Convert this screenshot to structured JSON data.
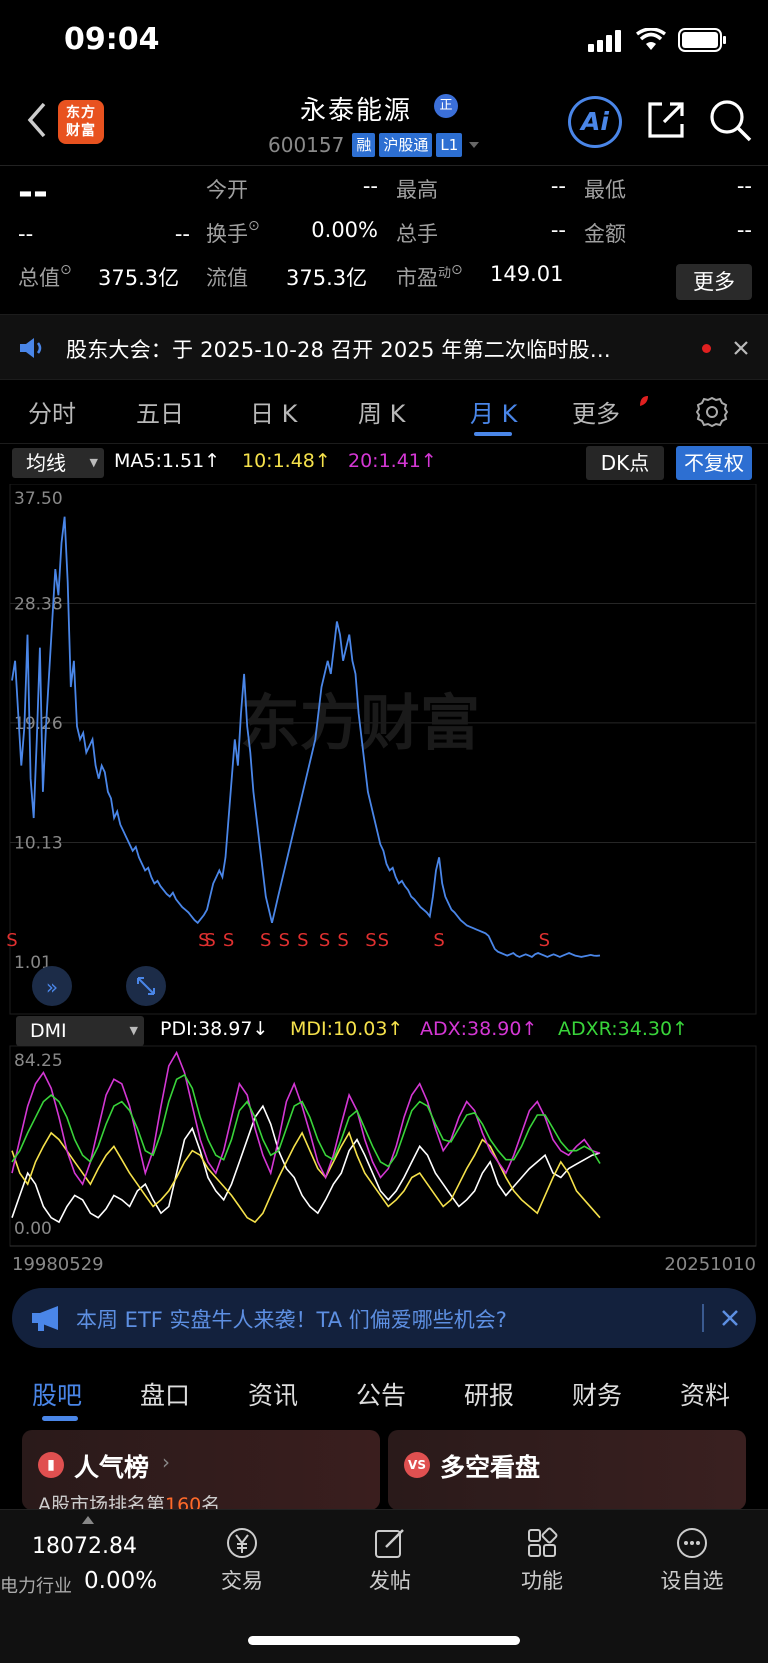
{
  "status_bar": {
    "time": "09:04"
  },
  "header": {
    "logo_text": "东方财富",
    "stock_name": "永泰能源",
    "badge": "正",
    "code": "600157",
    "tags": [
      "融",
      "沪股通",
      "L1"
    ],
    "ai_label": "Ai"
  },
  "quote": {
    "price": "--",
    "change": "--",
    "change_pct": "--",
    "open_label": "今开",
    "open": "--",
    "high_label": "最高",
    "high": "--",
    "low_label": "最低",
    "low": "--",
    "turnover_label": "换手",
    "turnover": "0.00%",
    "volume_label": "总手",
    "volume": "--",
    "amount_label": "金额",
    "amount": "--",
    "mktcap_label": "总值",
    "mktcap": "375.3亿",
    "float_label": "流值",
    "float": "375.3亿",
    "pe_label": "市盈",
    "pe_sup": "动",
    "pe": "149.01",
    "more": "更多"
  },
  "notice": {
    "text": "股东大会：于 2025-10-28 召开 2025 年第二次临时股…"
  },
  "period_tabs": [
    {
      "label": "分时"
    },
    {
      "label": "五日"
    },
    {
      "label": "日 K"
    },
    {
      "label": "周 K"
    },
    {
      "label": "月 K",
      "active": true
    },
    {
      "label": "更多"
    }
  ],
  "ma_bar": {
    "selector": "均线",
    "ma5": "MA5:1.51",
    "ma10": "10:1.48",
    "ma20": "20:1.41",
    "arrow": "↑",
    "dk": "DK点",
    "adjust": "不复权"
  },
  "colors": {
    "price_line": "#4a86e8",
    "ma10": "#f5e14b",
    "ma20": "#d437d4",
    "adxr": "#39d43a",
    "up": "#e03030",
    "accent": "#4a86e8"
  },
  "chart_data": [
    {
      "type": "line",
      "title": "",
      "y_ticks": [
        "37.50",
        "28.38",
        "19.26",
        "10.13",
        "1.01"
      ],
      "ylim": [
        1.01,
        37.5
      ],
      "x_start": "19980529",
      "x_end": "20251010",
      "series": [
        {
          "values": [
            22.5,
            24,
            20,
            16,
            19,
            26,
            15,
            12,
            18,
            25,
            14,
            19,
            23,
            27,
            31,
            29,
            33,
            35,
            30,
            22,
            24,
            19,
            18,
            18.5,
            17,
            17.5,
            18,
            16,
            15,
            16,
            15.5,
            14,
            13.5,
            12,
            12.5,
            11.5,
            11,
            10.5,
            10,
            9.5,
            9.8,
            9,
            8.5,
            8,
            8.2,
            7.5,
            7,
            7.2,
            6.8,
            6.5,
            6.2,
            6,
            6.3,
            5.8,
            5.5,
            5.2,
            5,
            4.8,
            4.5,
            4.2,
            4,
            4.3,
            4.6,
            5,
            6,
            7,
            7.5,
            8,
            7.5,
            9,
            12,
            15,
            18,
            16,
            20,
            23,
            19,
            17,
            14,
            12,
            10,
            8,
            6,
            5,
            4,
            5,
            6,
            7,
            8,
            9,
            10,
            11,
            12,
            13,
            14,
            15,
            16,
            17,
            18,
            20,
            22,
            23,
            24,
            23,
            25,
            27,
            26,
            24,
            25,
            26,
            24,
            23,
            20,
            18,
            16,
            14,
            13,
            12,
            11,
            10,
            9.5,
            8.5,
            8,
            8.2,
            7.5,
            7,
            7.2,
            6.8,
            6.5,
            6,
            5.8,
            5.5,
            5.2,
            5,
            4.8,
            4.5,
            6,
            8,
            9,
            7,
            6,
            5.5,
            5,
            4.8,
            4.5,
            4.2,
            4,
            3.8,
            3.7,
            3.6,
            3.5,
            3.4,
            3.3,
            3.2,
            3,
            2.5,
            2,
            1.8,
            1.7,
            1.6,
            1.5,
            1.6,
            1.7,
            1.5,
            1.4,
            1.5,
            1.6,
            1.5,
            1.4,
            1.6,
            1.7,
            1.6,
            1.5,
            1.4,
            1.5,
            1.6,
            1.5,
            1.4,
            1.5,
            1.6,
            1.7,
            1.6,
            1.5,
            1.45,
            1.4,
            1.45,
            1.5,
            1.55,
            1.5,
            1.48,
            1.51
          ]
        }
      ],
      "signals": [
        {
          "label": "S",
          "index": 0
        },
        {
          "label": "S",
          "index": 62
        },
        {
          "label": "S",
          "index": 64
        },
        {
          "label": "S",
          "index": 70
        },
        {
          "label": "S",
          "index": 82
        },
        {
          "label": "S",
          "index": 88
        },
        {
          "label": "S",
          "index": 94
        },
        {
          "label": "S",
          "index": 101
        },
        {
          "label": "S",
          "index": 107
        },
        {
          "label": "S",
          "index": 116
        },
        {
          "label": "S",
          "index": 120
        },
        {
          "label": "S",
          "index": 138
        },
        {
          "label": "S",
          "index": 172
        }
      ]
    },
    {
      "type": "line",
      "title": "",
      "indicator": "DMI",
      "y_ticks": [
        "84.25",
        "0.00"
      ],
      "ylim": [
        0,
        84.25
      ],
      "series": [
        {
          "name": "PDI",
          "latest": "PDI:38.97",
          "arrow": "↓",
          "values": [
            10,
            20,
            30,
            25,
            15,
            10,
            8,
            15,
            20,
            18,
            12,
            10,
            14,
            20,
            18,
            15,
            22,
            25,
            18,
            12,
            15,
            30,
            45,
            50,
            40,
            28,
            22,
            18,
            25,
            35,
            45,
            55,
            60,
            52,
            40,
            32,
            28,
            20,
            15,
            12,
            18,
            25,
            30,
            40,
            45,
            38,
            30,
            22,
            18,
            22,
            28,
            35,
            42,
            38,
            30,
            25,
            20,
            15,
            18,
            22,
            30,
            35,
            25,
            20,
            24,
            28,
            32,
            35,
            38,
            30,
            28,
            32,
            34,
            36,
            38,
            39
          ]
        },
        {
          "name": "MDI",
          "latest": "MDI:10.03",
          "arrow": "↑",
          "values": [
            40,
            30,
            25,
            35,
            42,
            48,
            45,
            40,
            35,
            30,
            25,
            32,
            38,
            42,
            36,
            30,
            25,
            20,
            15,
            18,
            22,
            28,
            35,
            40,
            38,
            32,
            28,
            24,
            20,
            15,
            10,
            8,
            12,
            20,
            28,
            35,
            42,
            48,
            40,
            32,
            28,
            35,
            42,
            48,
            38,
            30,
            25,
            20,
            15,
            18,
            22,
            28,
            30,
            25,
            20,
            15,
            18,
            25,
            32,
            38,
            45,
            42,
            35,
            28,
            22,
            18,
            15,
            12,
            20,
            28,
            35,
            30,
            22,
            18,
            14,
            10
          ]
        },
        {
          "name": "ADX",
          "latest": "ADX:38.90",
          "arrow": "↑",
          "values": [
            30,
            45,
            60,
            70,
            75,
            68,
            55,
            40,
            30,
            25,
            35,
            50,
            65,
            72,
            70,
            60,
            45,
            30,
            40,
            60,
            78,
            84,
            75,
            60,
            45,
            35,
            30,
            40,
            55,
            70,
            65,
            50,
            38,
            30,
            45,
            62,
            70,
            60,
            48,
            35,
            28,
            38,
            52,
            65,
            58,
            45,
            35,
            28,
            32,
            42,
            55,
            65,
            70,
            62,
            50,
            40,
            45,
            55,
            62,
            58,
            48,
            40,
            35,
            30,
            38,
            48,
            58,
            62,
            55,
            45,
            40,
            38,
            42,
            45,
            40,
            38.9
          ]
        },
        {
          "name": "ADXR",
          "latest": "ADXR:34.30",
          "arrow": "↑",
          "values": [
            35,
            40,
            48,
            55,
            62,
            65,
            62,
            55,
            45,
            38,
            35,
            42,
            52,
            60,
            62,
            58,
            50,
            40,
            38,
            48,
            62,
            72,
            74,
            68,
            55,
            45,
            38,
            36,
            45,
            58,
            62,
            55,
            45,
            38,
            40,
            50,
            60,
            62,
            55,
            45,
            38,
            36,
            45,
            55,
            58,
            50,
            42,
            35,
            33,
            38,
            48,
            58,
            62,
            60,
            52,
            45,
            44,
            50,
            56,
            57,
            52,
            45,
            40,
            36,
            36,
            42,
            50,
            56,
            56,
            50,
            44,
            40,
            40,
            42,
            40,
            34.3
          ]
        }
      ]
    }
  ],
  "watermark": "东方财富",
  "banner": {
    "text": "本周 ETF 实盘牛人来袭！TA 们偏爱哪些机会?"
  },
  "bottom_tabs": [
    {
      "label": "股吧",
      "active": true
    },
    {
      "label": "盘口"
    },
    {
      "label": "资讯"
    },
    {
      "label": "公告"
    },
    {
      "label": "研报"
    },
    {
      "label": "财务"
    },
    {
      "label": "资料"
    }
  ],
  "cards": [
    {
      "title": "人气榜",
      "subtitle_prefix": "A股市场排名第",
      "rank": "160",
      "subtitle_suffix": "名"
    },
    {
      "title": "多空看盘"
    }
  ],
  "bottom_nav": {
    "index_value": "18072.84",
    "index_name": "电力行业",
    "index_change": "0.00%",
    "items": [
      {
        "label": "交易",
        "icon": "yen-icon"
      },
      {
        "label": "发帖",
        "icon": "edit-icon"
      },
      {
        "label": "功能",
        "icon": "grid-icon"
      },
      {
        "label": "设自选",
        "icon": "dots-icon"
      }
    ]
  }
}
